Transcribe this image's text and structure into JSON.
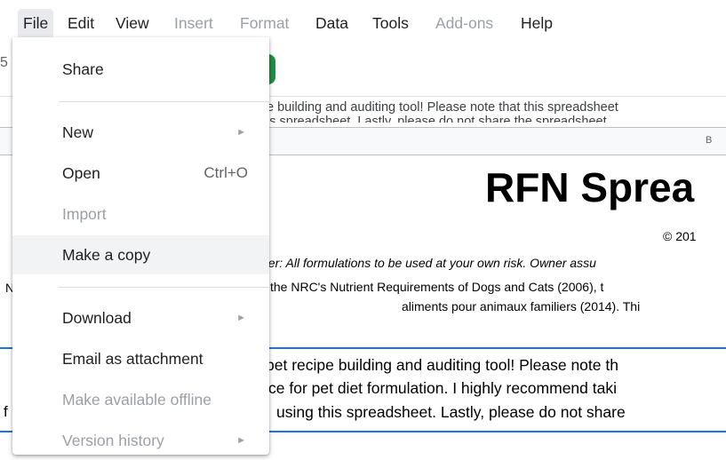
{
  "menubar": {
    "items": [
      {
        "label": "File",
        "state": "active"
      },
      {
        "label": "Edit",
        "state": "normal"
      },
      {
        "label": "View",
        "state": "normal"
      },
      {
        "label": "Insert",
        "state": "disabled"
      },
      {
        "label": "Format",
        "state": "disabled"
      },
      {
        "label": "Data",
        "state": "normal"
      },
      {
        "label": "Tools",
        "state": "normal"
      },
      {
        "label": "Add-ons",
        "state": "disabled"
      },
      {
        "label": "Help",
        "state": "normal"
      }
    ]
  },
  "file_menu": {
    "share": "Share",
    "new": "New",
    "open": "Open",
    "open_shortcut": "Ctrl+O",
    "import": "Import",
    "make_copy": "Make a copy",
    "download": "Download",
    "email": "Email as attachment",
    "offline": "Make available offline",
    "version_history": "Version history",
    "submenu_arrow": "►"
  },
  "sheet": {
    "formula_line1": "e building and auditing tool! Please note that this spreadsheet",
    "formula_line2": "is spreadsheet. Lastly, please do not share the spreadsheet",
    "column_b": "B",
    "title": "RFN Sprea",
    "copyright": "© 201",
    "disclaimer_line1": "ner: All formulations to be used at your own risk. Owner assu",
    "disclaimer_line2": "the NRC's Nutrient Requirements of Dogs and Cats (2006), t",
    "disclaimer_line3": "aliments pour animaux familiers (2014). Thi",
    "note_line1": "pet recipe building and auditing tool! Please note th",
    "note_line2": "ce for pet diet formulation. I highly recommend taki",
    "note_line3": "using this spreadsheet. Lastly, please do not share",
    "edge_n": "N",
    "edge_f": "f",
    "toolbar_edge": "5"
  },
  "colors": {
    "accent_blue": "#1a73e8",
    "green_button": "#1e8e3e",
    "disabled_text": "#9aa0a6",
    "active_menu_bg": "#e8eaed",
    "hover_item_bg": "#f1f3f4"
  }
}
